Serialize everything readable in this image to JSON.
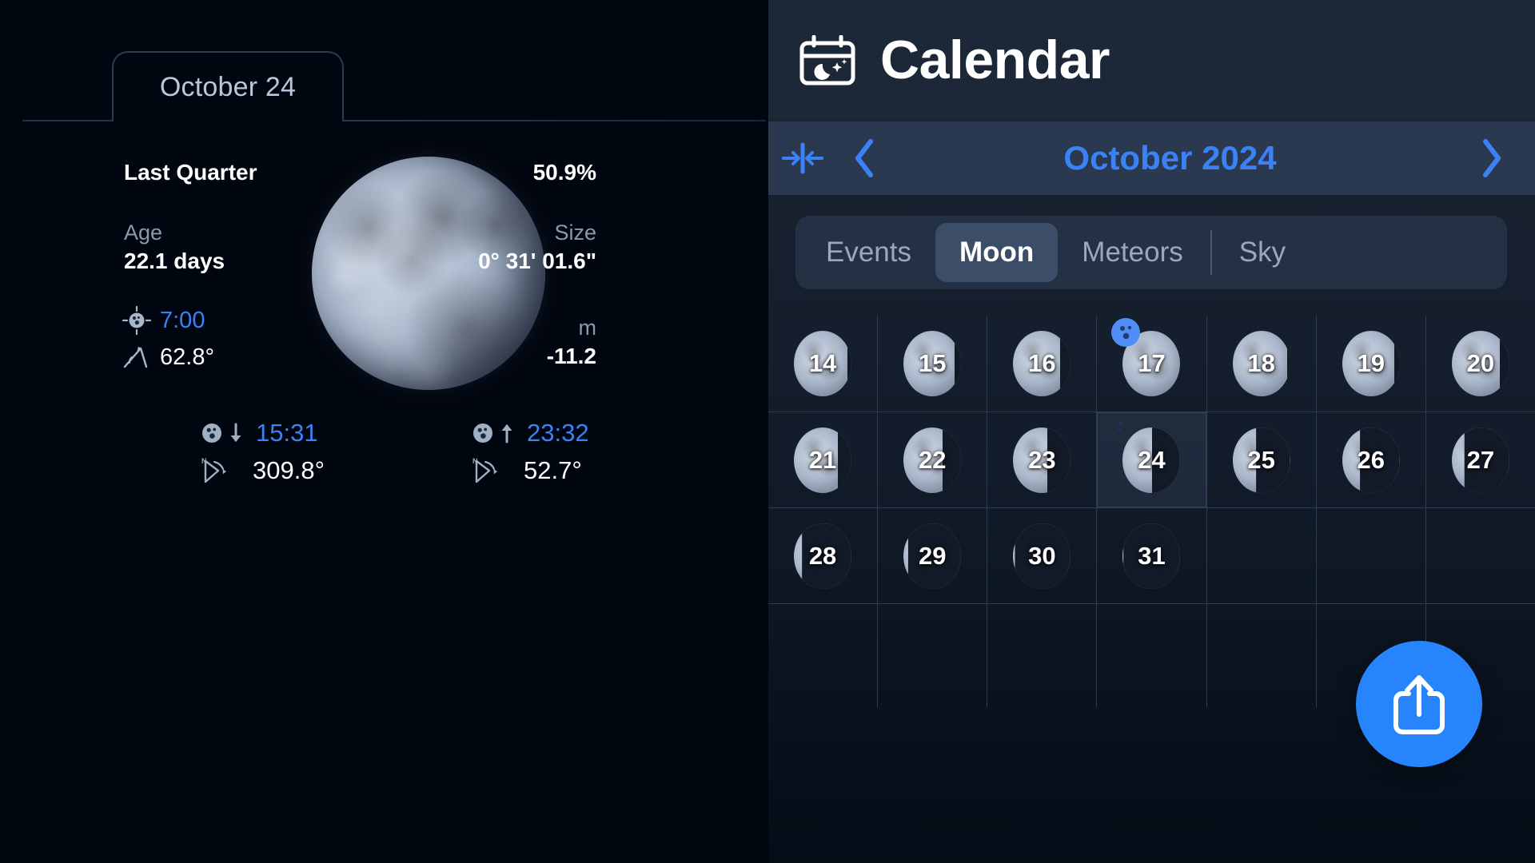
{
  "left_panel": {
    "date_tab": {
      "label": "October 24"
    },
    "moon": {
      "phase_name": "Last Quarter",
      "illumination": "50.9%",
      "age_label": "Age",
      "age_value": "22.1 days",
      "size_label": "Size",
      "size_value": "0° 31' 01.6\"",
      "magnitude_label": "m",
      "magnitude_value": "-11.2",
      "culmination_icon": "moon-culmination-icon",
      "culmination_time": "7:00",
      "altitude_icon": "altitude-angle-icon",
      "altitude_value": "62.8°",
      "moon_image_icon": "moon-disc-image"
    },
    "moonset": {
      "icon": "moon-set-icon",
      "arrow_icon": "arrow-down-icon",
      "time": "15:31",
      "azimuth_icon": "azimuth-north-icon",
      "azimuth": "309.8°"
    },
    "moonrise": {
      "icon": "moon-rise-icon",
      "arrow_icon": "arrow-up-icon",
      "time": "23:32",
      "azimuth_icon": "azimuth-north-icon",
      "azimuth": "52.7°"
    }
  },
  "right_panel": {
    "header": {
      "icon": "calendar-moon-icon",
      "title": "Calendar"
    },
    "month_bar": {
      "today_icon": "jump-to-today-icon",
      "prev_icon": "chevron-left-icon",
      "month": "October 2024",
      "next_icon": "chevron-right-icon"
    },
    "tabs": [
      {
        "label": "Events",
        "active": false
      },
      {
        "label": "Moon",
        "active": true
      },
      {
        "label": "Meteors",
        "active": false
      },
      {
        "label": "Sky",
        "active": false
      }
    ],
    "calendar": {
      "rows": [
        [
          {
            "day": "14",
            "illum": 0.93,
            "waning": true,
            "selected": false,
            "badge": null
          },
          {
            "day": "15",
            "illum": 0.88,
            "waning": true,
            "selected": false,
            "badge": null
          },
          {
            "day": "16",
            "illum": 0.82,
            "waning": true,
            "selected": false,
            "badge": null
          },
          {
            "day": "17",
            "illum": 0.99,
            "waning": true,
            "selected": false,
            "badge": "full-moon"
          },
          {
            "day": "18",
            "illum": 0.95,
            "waning": true,
            "selected": false,
            "badge": null
          },
          {
            "day": "19",
            "illum": 0.9,
            "waning": true,
            "selected": false,
            "badge": null
          },
          {
            "day": "20",
            "illum": 0.84,
            "waning": true,
            "selected": false,
            "badge": null
          }
        ],
        [
          {
            "day": "21",
            "illum": 0.76,
            "waning": true,
            "selected": false,
            "badge": null
          },
          {
            "day": "22",
            "illum": 0.68,
            "waning": true,
            "selected": false,
            "badge": null
          },
          {
            "day": "23",
            "illum": 0.59,
            "waning": true,
            "selected": false,
            "badge": null
          },
          {
            "day": "24",
            "illum": 0.51,
            "waning": true,
            "selected": true,
            "badge": "last-quarter"
          },
          {
            "day": "25",
            "illum": 0.41,
            "waning": true,
            "selected": false,
            "badge": null
          },
          {
            "day": "26",
            "illum": 0.31,
            "waning": true,
            "selected": false,
            "badge": null
          },
          {
            "day": "27",
            "illum": 0.22,
            "waning": true,
            "selected": false,
            "badge": null
          }
        ],
        [
          {
            "day": "28",
            "illum": 0.14,
            "waning": true,
            "selected": false,
            "badge": null
          },
          {
            "day": "29",
            "illum": 0.08,
            "waning": true,
            "selected": false,
            "badge": null
          },
          {
            "day": "30",
            "illum": 0.03,
            "waning": true,
            "selected": false,
            "badge": null
          },
          {
            "day": "31",
            "illum": 0.01,
            "waning": true,
            "selected": false,
            "badge": null
          },
          {
            "day": "",
            "illum": 0,
            "waning": true,
            "selected": false,
            "badge": null
          },
          {
            "day": "",
            "illum": 0,
            "waning": true,
            "selected": false,
            "badge": null
          },
          {
            "day": "",
            "illum": 0,
            "waning": true,
            "selected": false,
            "badge": null
          }
        ]
      ]
    },
    "share_button": {
      "icon": "share-upload-icon"
    },
    "home_button": {
      "icon": "home-icon"
    }
  },
  "colors": {
    "accent_blue": "#3b82f6",
    "fab_blue": "#2684fc",
    "panel_bg": "#1b2637",
    "left_bg": "#00060f",
    "grid_line": "#2e3c52",
    "muted_text": "#8c99ac"
  }
}
